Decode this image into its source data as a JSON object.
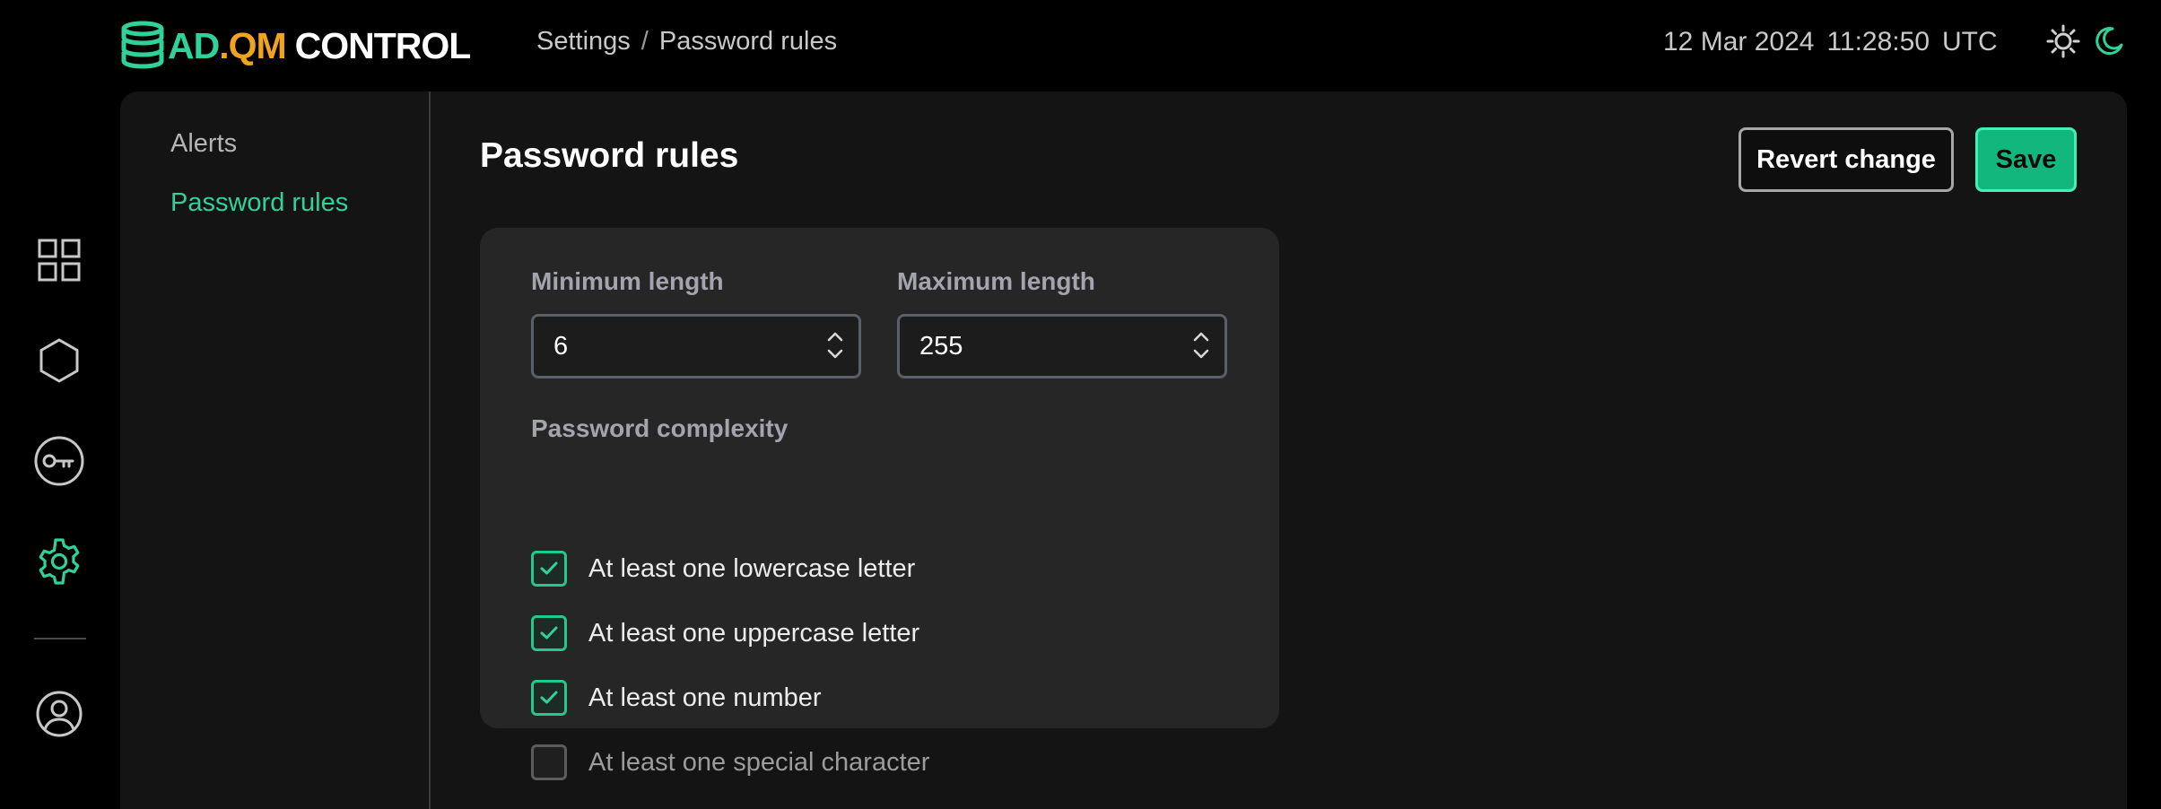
{
  "app": {
    "logo_prefix": "AD",
    "logo_dot": ".QM",
    "logo_suffix": "CONTROL",
    "brand_colors": {
      "ad": "#2fd39a",
      "qm": "#f0a41e",
      "control": "#ffffff"
    }
  },
  "header": {
    "breadcrumb": [
      "Settings",
      "Password rules"
    ],
    "breadcrumb_separator": "/",
    "date": "12 Mar 2024",
    "time": "11:28:50",
    "timezone": "UTC",
    "theme_icons": [
      "sun-icon",
      "moon-icon"
    ]
  },
  "rail": {
    "items": [
      {
        "icon": "dashboard-grid-icon",
        "active": false
      },
      {
        "icon": "hexagon-icon",
        "active": false
      },
      {
        "icon": "key-icon",
        "active": false
      },
      {
        "icon": "gear-icon",
        "active": true
      },
      {
        "icon": "user-profile-icon",
        "active": false
      }
    ]
  },
  "subnav": {
    "items": [
      {
        "label": "Alerts",
        "active": false
      },
      {
        "label": "Password rules",
        "active": true
      }
    ]
  },
  "main": {
    "title": "Password rules",
    "revert_label": "Revert change",
    "save_label": "Save",
    "min_length_label": "Minimum length",
    "min_length_value": "6",
    "max_length_label": "Maximum length",
    "max_length_value": "255",
    "complexity_label": "Password complexity",
    "rules": [
      {
        "label": "At least one lowercase letter",
        "checked": true
      },
      {
        "label": "At least one uppercase letter",
        "checked": true
      },
      {
        "label": "At least one number",
        "checked": true
      },
      {
        "label": "At least one special character",
        "checked": false
      }
    ]
  },
  "colors": {
    "accent": "#2fd39a",
    "save_button": "#12b77e",
    "background": "#000000",
    "panel": "#141414",
    "card": "#262626"
  }
}
